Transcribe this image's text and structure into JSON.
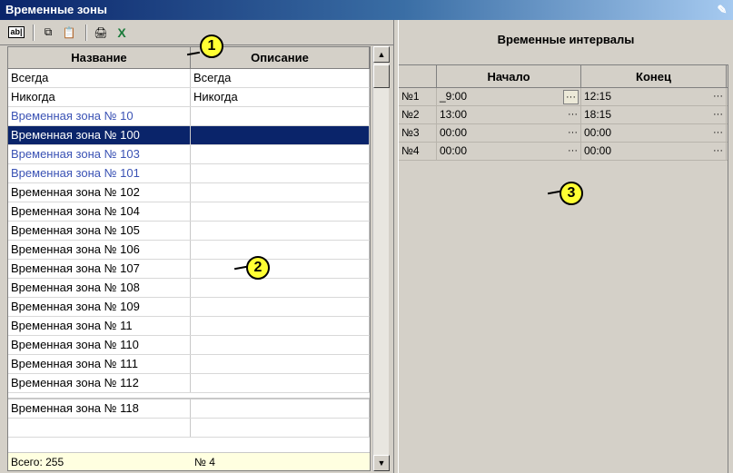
{
  "window": {
    "title": "Временные зоны"
  },
  "callouts": {
    "c1": "1",
    "c2": "2",
    "c3": "3"
  },
  "left_grid": {
    "headers": {
      "name": "Название",
      "description": "Описание"
    },
    "rows": [
      {
        "name": "Всегда",
        "description": "Всегда"
      },
      {
        "name": "Никогда",
        "description": "Никогда"
      },
      {
        "name": "Временная зона № 10",
        "description": ""
      },
      {
        "name": "Временная зона № 100",
        "description": ""
      },
      {
        "name": "Временная зона № 103",
        "description": ""
      },
      {
        "name": "Временная зона № 101",
        "description": ""
      },
      {
        "name": "Временная зона № 102",
        "description": ""
      },
      {
        "name": "Временная зона № 104",
        "description": ""
      },
      {
        "name": "Временная зона № 105",
        "description": ""
      },
      {
        "name": "Временная зона № 106",
        "description": ""
      },
      {
        "name": "Временная зона № 107",
        "description": ""
      },
      {
        "name": "Временная зона № 108",
        "description": ""
      },
      {
        "name": "Временная зона № 109",
        "description": ""
      },
      {
        "name": "Временная зона № 11",
        "description": ""
      },
      {
        "name": "Временная зона № 110",
        "description": ""
      },
      {
        "name": "Временная зона № 111",
        "description": ""
      },
      {
        "name": "Временная зона № 112",
        "description": ""
      }
    ],
    "extra_row": {
      "name": "Временная зона № 118",
      "description": ""
    },
    "footer": {
      "total": "Всего: 255",
      "current": "№ 4"
    }
  },
  "right_panel": {
    "title": "Временные интервалы",
    "headers": {
      "num": "",
      "start": "Начало",
      "end": "Конец"
    },
    "rows": [
      {
        "num": "№1",
        "start": "_9:00",
        "end": "12:15"
      },
      {
        "num": "№2",
        "start": "13:00",
        "end": "18:15"
      },
      {
        "num": "№3",
        "start": "00:00",
        "end": "00:00"
      },
      {
        "num": "№4",
        "start": "00:00",
        "end": "00:00"
      }
    ],
    "ellipsis": "···"
  },
  "colors": {
    "selection": "#0a246a",
    "link_text": "#3a52b4",
    "callout_fill": "#ffff33",
    "footer_bg": "#ffffe0"
  }
}
